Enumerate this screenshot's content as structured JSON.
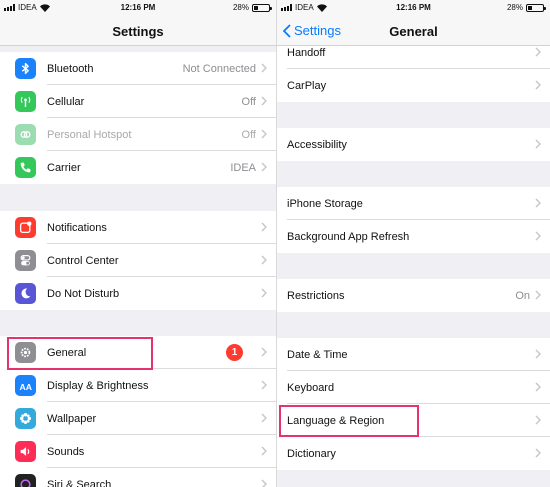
{
  "colors": {
    "accent": "#0a7aff",
    "highlight": "#e7336c",
    "badge": "#ff3b30"
  },
  "left": {
    "status": {
      "carrier": "IDEA",
      "time": "12:16 PM",
      "battery": "28%",
      "battery_level": 0.28
    },
    "title": "Settings",
    "groups": [
      [
        {
          "label": "Bluetooth",
          "value": "Not Connected",
          "icon": "bluetooth-icon",
          "color": "#1a82fb"
        },
        {
          "label": "Cellular",
          "value": "Off",
          "icon": "cellular-icon",
          "color": "#34c759"
        },
        {
          "label": "Personal Hotspot",
          "value": "Off",
          "icon": "hotspot-icon",
          "color": "#9bddb0"
        },
        {
          "label": "Carrier",
          "value": "IDEA",
          "icon": "phone-icon",
          "color": "#34c759"
        }
      ],
      [
        {
          "label": "Notifications",
          "value": "",
          "icon": "notifications-icon",
          "color": "#ff3b30"
        },
        {
          "label": "Control Center",
          "value": "",
          "icon": "control-center-icon",
          "color": "#8e8e93"
        },
        {
          "label": "Do Not Disturb",
          "value": "",
          "icon": "moon-icon",
          "color": "#5856d6"
        }
      ],
      [
        {
          "label": "General",
          "value": "",
          "icon": "gear-icon",
          "color": "#8e8e93",
          "badge": "1"
        },
        {
          "label": "Display & Brightness",
          "value": "",
          "icon": "display-icon",
          "color": "#1a82fb"
        },
        {
          "label": "Wallpaper",
          "value": "",
          "icon": "wallpaper-icon",
          "color": "#34aadc"
        },
        {
          "label": "Sounds",
          "value": "",
          "icon": "sound-icon",
          "color": "#ff2d55"
        },
        {
          "label": "Siri & Search",
          "value": "",
          "icon": "siri-icon",
          "color": "#222"
        }
      ]
    ]
  },
  "right": {
    "status": {
      "carrier": "IDEA",
      "time": "12:16 PM",
      "battery": "28%",
      "battery_level": 0.28
    },
    "back_label": "Settings",
    "title": "General",
    "groups": [
      [
        {
          "label": "Handoff",
          "value": ""
        },
        {
          "label": "CarPlay",
          "value": ""
        }
      ],
      [
        {
          "label": "Accessibility",
          "value": ""
        }
      ],
      [
        {
          "label": "iPhone Storage",
          "value": ""
        },
        {
          "label": "Background App Refresh",
          "value": ""
        }
      ],
      [
        {
          "label": "Restrictions",
          "value": "On"
        }
      ],
      [
        {
          "label": "Date & Time",
          "value": ""
        },
        {
          "label": "Keyboard",
          "value": ""
        },
        {
          "label": "Language & Region",
          "value": ""
        },
        {
          "label": "Dictionary",
          "value": ""
        }
      ]
    ]
  }
}
